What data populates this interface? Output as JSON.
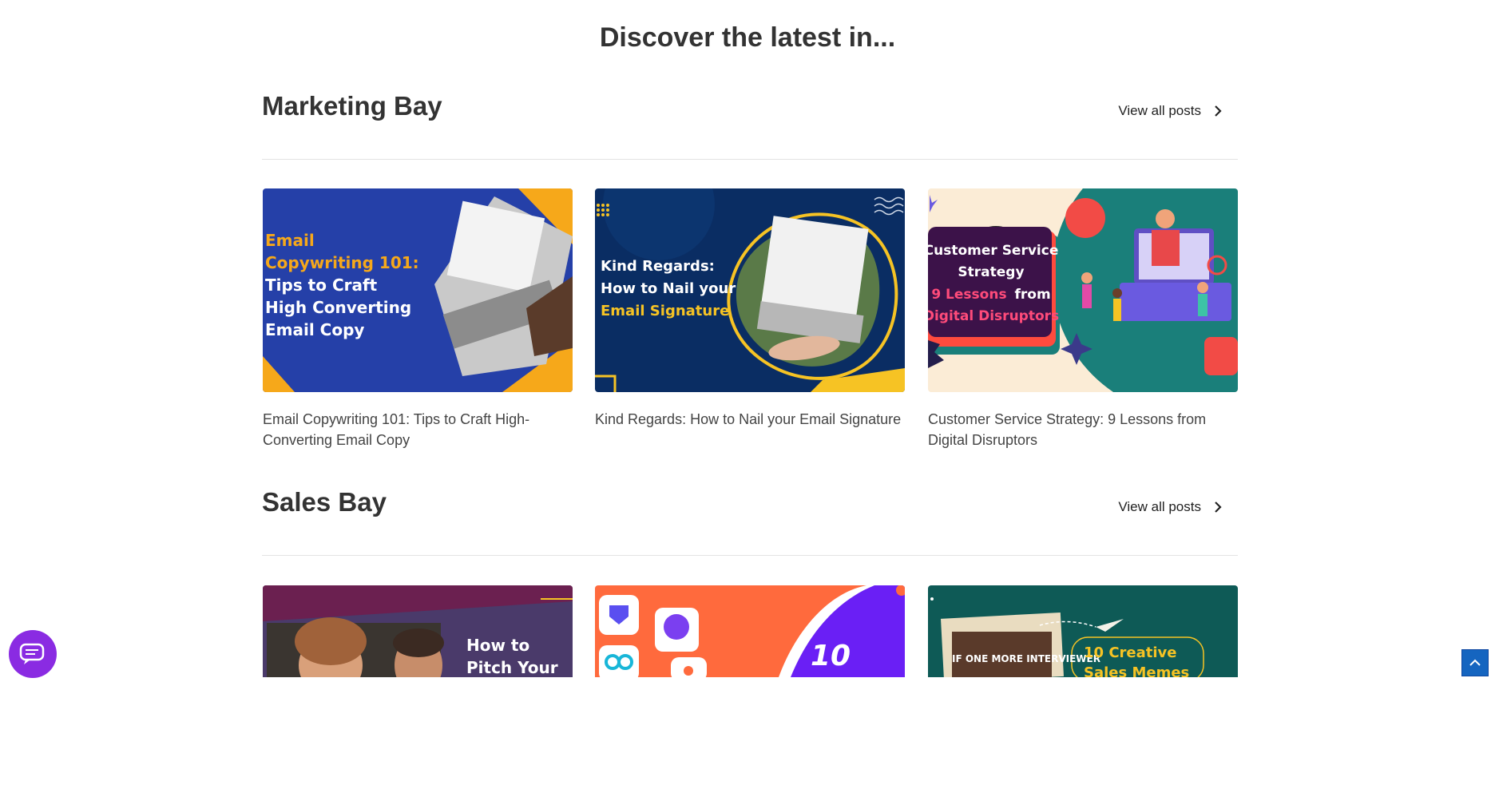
{
  "page": {
    "title": "Discover the latest in..."
  },
  "sections": [
    {
      "heading": "Marketing Bay",
      "view_all": "View all posts",
      "cards": [
        {
          "title": "Email Copywriting 101: Tips to Craft High-Converting Email Copy",
          "thumb_lines": [
            "Email",
            "Copywriting 101:",
            "Tips to Craft",
            "High Converting",
            "Email Copy"
          ]
        },
        {
          "title": "Kind Regards: How to Nail your Email Signature",
          "thumb_lines": [
            "Kind Regards:",
            "How to Nail your",
            "Email Signature"
          ]
        },
        {
          "title": "Customer Service Strategy: 9 Lessons from Digital Disruptors",
          "thumb_lines": [
            "Customer Service",
            "Strategy",
            "9 Lessons",
            "from",
            "Digital Disruptors"
          ]
        }
      ]
    },
    {
      "heading": "Sales Bay",
      "view_all": "View all posts",
      "cards": [
        {
          "thumb_lines": [
            "How to",
            "Pitch Your"
          ]
        },
        {
          "thumb_lines": [
            "10"
          ]
        },
        {
          "thumb_lines": [
            "10 Creative",
            "Sales Memes",
            "IF ONE MORE INTERVIEWER"
          ]
        }
      ]
    }
  ],
  "colors": {
    "accent_purple": "#8a2be2",
    "scroll_blue": "#1565c0",
    "heading": "#333333"
  },
  "icons": {
    "view_all": "chevron-right-icon",
    "chat": "chat-bubble-icon",
    "scroll": "arrow-up-icon"
  }
}
